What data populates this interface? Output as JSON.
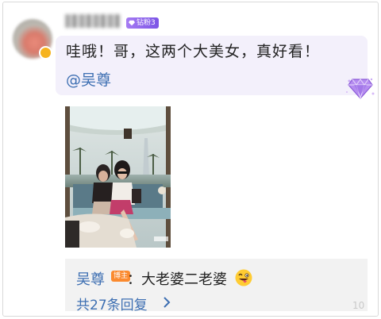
{
  "comment": {
    "level_badge": "钻粉3",
    "text": "哇哦！哥，这两个大美女，真好看！",
    "mention": "@吴尊"
  },
  "reply": {
    "author": "吴尊",
    "badge": "博主",
    "text": "：大老婆二老婆",
    "count_text": "共27条回复"
  },
  "watermark": "10",
  "icons": {
    "diamond": "diamond-icon",
    "emoji": "tongue-face-icon",
    "chevron": "chevron-right-icon"
  },
  "colors": {
    "link": "#3d6fb2",
    "bubble": "#f3f0fb",
    "badge_purple": "#8b63ec",
    "badge_orange": "#fb8a2f"
  }
}
